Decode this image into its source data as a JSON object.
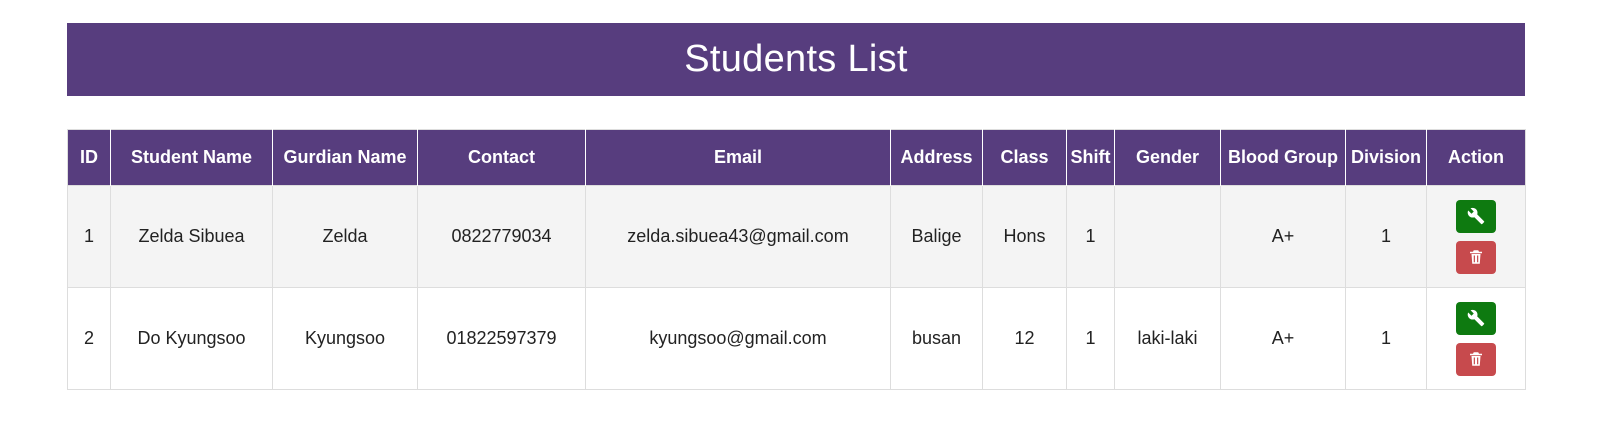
{
  "header": {
    "title": "Students List"
  },
  "table": {
    "columns": [
      "ID",
      "Student Name",
      "Gurdian Name",
      "Contact",
      "Email",
      "Address",
      "Class",
      "Shift",
      "Gender",
      "Blood Group",
      "Division",
      "Action"
    ],
    "rows": [
      {
        "id": "1",
        "student_name": "Zelda Sibuea",
        "guardian_name": "Zelda",
        "contact": "0822779034",
        "email": "zelda.sibuea43@gmail.com",
        "address": "Balige",
        "class": "Hons",
        "shift": "1",
        "gender": "",
        "blood_group": "A+",
        "division": "1"
      },
      {
        "id": "2",
        "student_name": "Do Kyungsoo",
        "guardian_name": "Kyungsoo",
        "contact": "01822597379",
        "email": "kyungsoo@gmail.com",
        "address": "busan",
        "class": "12",
        "shift": "1",
        "gender": "laki-laki",
        "blood_group": "A+",
        "division": "1"
      }
    ]
  },
  "icons": {
    "edit": "wrench-icon",
    "delete": "trash-icon"
  },
  "colors": {
    "primary": "#573d7e",
    "edit_button": "#0e7a10",
    "delete_button": "#c74a4d",
    "row_stripe": "#f4f4f4"
  }
}
